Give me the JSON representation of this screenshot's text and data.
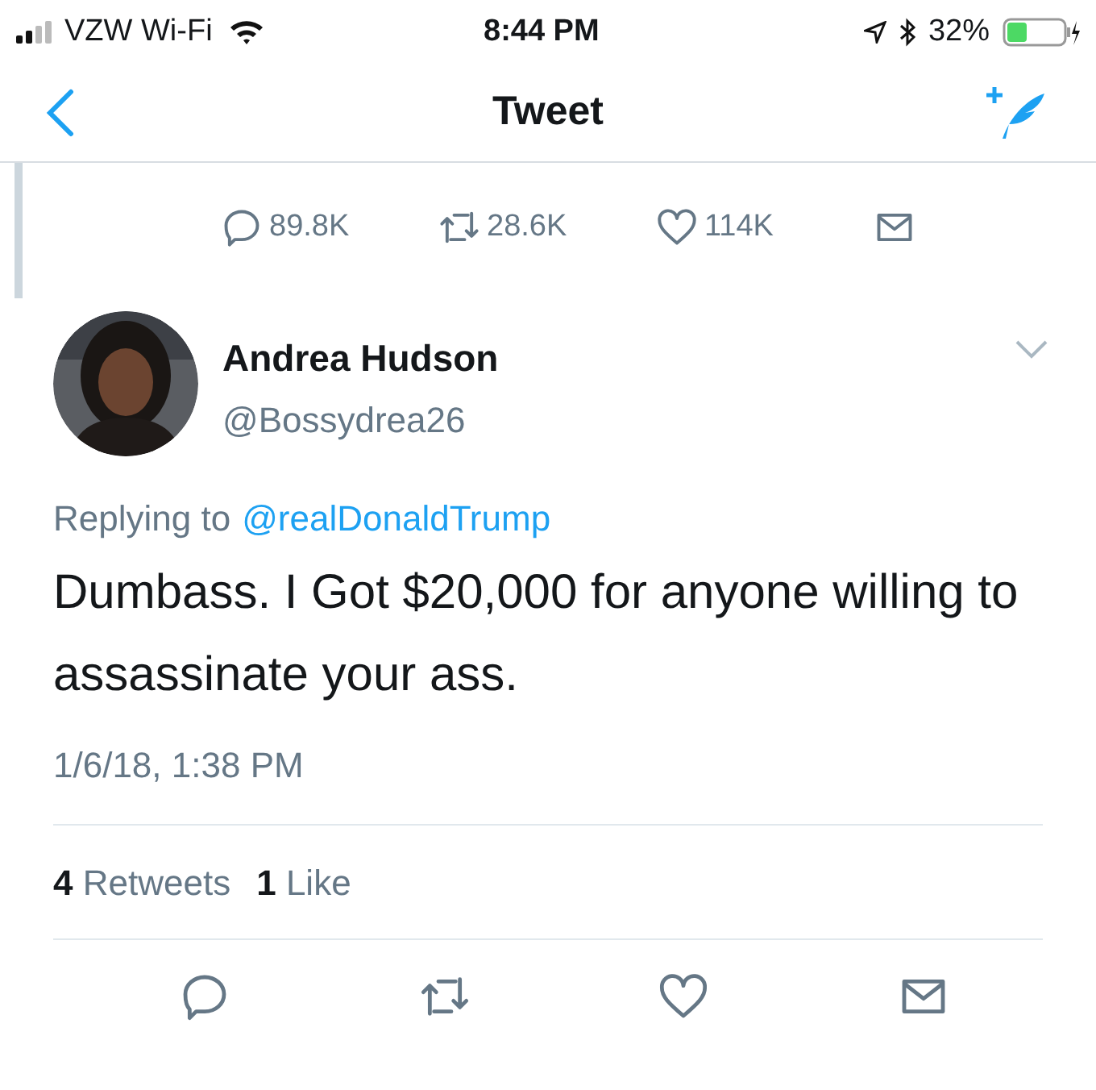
{
  "status_bar": {
    "carrier": "VZW Wi-Fi",
    "time": "8:44 PM",
    "battery": "32%"
  },
  "nav": {
    "title": "Tweet"
  },
  "parent_tweet": {
    "stats": [
      {
        "kind": "reply",
        "count": "89.8K"
      },
      {
        "kind": "retweet",
        "count": "28.6K"
      },
      {
        "kind": "like",
        "count": "114K"
      },
      {
        "kind": "message"
      }
    ]
  },
  "tweet": {
    "name": "Andrea Hudson",
    "handle": "@Bossydrea26",
    "replying_label": "Replying to",
    "replying_to": "@realDonaldTrump",
    "text": "Dumbass. I Got $20,000 for anyone willing to assassinate your ass.",
    "timestamp": "1/6/18, 1:38 PM",
    "counts": [
      {
        "count": "4",
        "label": "Retweets"
      },
      {
        "count": "1",
        "label": "Like"
      }
    ],
    "actions": [
      {
        "kind": "reply"
      },
      {
        "kind": "retweet"
      },
      {
        "kind": "like"
      },
      {
        "kind": "message"
      }
    ]
  }
}
